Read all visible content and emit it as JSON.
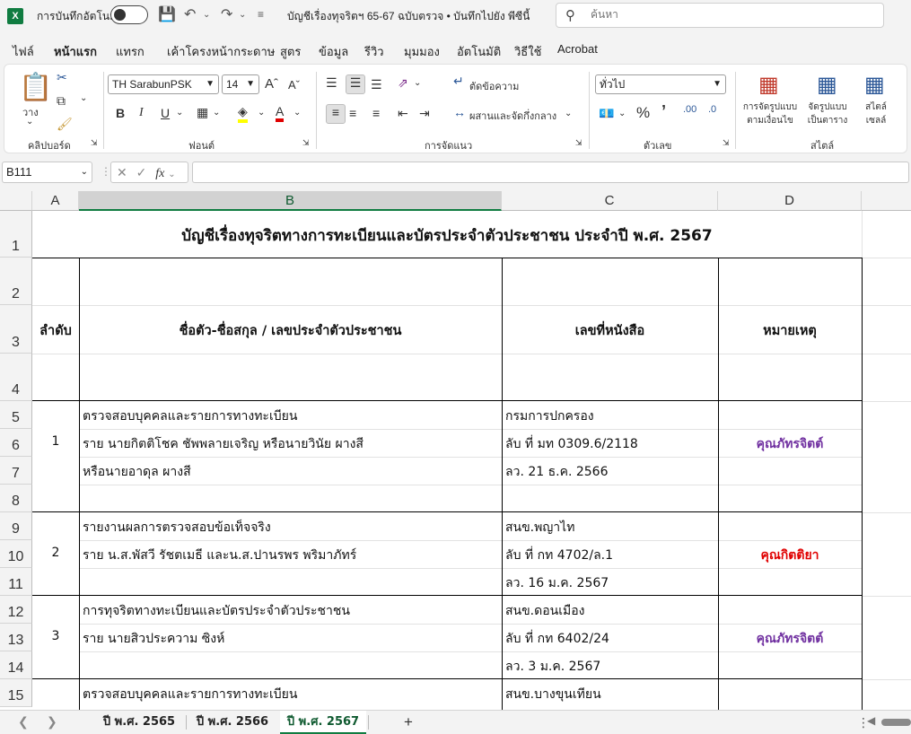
{
  "titlebar": {
    "app_icon": "X",
    "autosave_label": "การบันทึกอัตโนมัติ",
    "autosave_state": "off",
    "document_title": "บัญชีเรื่องทุจริตฯ 65-67 ฉบับตรวจ • บันทึกไปยัง พีซีนี้",
    "search_placeholder": "ค้นหา"
  },
  "ribbon_tabs": [
    "ไฟล์",
    "หน้าแรก",
    "แทรก",
    "เค้าโครงหน้ากระดาษ",
    "สูตร",
    "ข้อมูล",
    "รีวิว",
    "มุมมอง",
    "อัตโนมัติ",
    "วิธีใช้",
    "Acrobat"
  ],
  "active_tab": "หน้าแรก",
  "ribbon": {
    "clipboard": {
      "paste_label": "วาง",
      "group_label": "คลิปบอร์ด"
    },
    "font": {
      "font_name": "TH SarabunPSK",
      "font_size": "14",
      "group_label": "ฟอนต์"
    },
    "alignment": {
      "wrap_text": "ตัดข้อความ",
      "merge_center": "ผสานและจัดกึ่งกลาง",
      "group_label": "การจัดแนว"
    },
    "number": {
      "format": "ทั่วไป",
      "group_label": "ตัวเลข"
    },
    "styles": {
      "conditional_line1": "การจัดรูปแบบ",
      "conditional_line2": "ตามเงื่อนไข",
      "table_line1": "จัดรูปแบบ",
      "table_line2": "เป็นตาราง",
      "cell_line1": "สไตล์",
      "cell_line2": "เซลล์",
      "group_label": "สไตล์"
    }
  },
  "formula_bar": {
    "name_box": "B111",
    "formula": ""
  },
  "columns": [
    "A",
    "B",
    "C",
    "D"
  ],
  "selected_column": "B",
  "rows": [
    "1",
    "2",
    "3",
    "4",
    "5",
    "6",
    "7",
    "8",
    "9",
    "10",
    "11",
    "12",
    "13",
    "14",
    "15"
  ],
  "sheet": {
    "title": "บัญชีเรื่องทุจริตทางการทะเบียนและบัตรประจำตัวประชาชน ประจำปี พ.ศ. 2567",
    "headers": {
      "no": "ลำดับ",
      "name": "ชื่อตัว-ชื่อสกุล / เลขประจำตัวประชาชน",
      "letter": "เลขที่หนังสือ",
      "note": "หมายเหตุ"
    },
    "entries": [
      {
        "no": "1",
        "b": [
          "ตรวจสอบบุคคลและรายการทางทะเบียน",
          "ราย นายกิตติโชค ชัพพลายเจริญ หรือนายวินัย ผางสี",
          "หรือนายอาดุล ผางสี",
          ""
        ],
        "c": [
          "กรมการปกครอง",
          "ลับ ที่ มท 0309.6/2118",
          "ลว. 21 ธ.ค. 2566",
          ""
        ],
        "note": "คุณภัทรจิตต์",
        "note_color": "#7030a0"
      },
      {
        "no": "2",
        "b": [
          "รายงานผลการตรวจสอบข้อเท็จจริง",
          "ราย น.ส.พัสวี รัชตเมธี และน.ส.ปานรพร พริมาภัทร์",
          ""
        ],
        "c": [
          "สนข.พญาไท",
          "ลับ ที่ กท 4702/ล.1",
          "ลว. 16 ม.ค. 2567"
        ],
        "note": "คุณกิตติยา",
        "note_color": "#e00000"
      },
      {
        "no": "3",
        "b": [
          "การทุจริตทางทะเบียนและบัตรประจำตัวประชาชน",
          "ราย นายสิวประความ ซิงห์",
          ""
        ],
        "c": [
          "สนข.ดอนเมือง",
          "ลับ ที่ กท 6402/24",
          "ลว. 3 ม.ค. 2567"
        ],
        "note": "คุณภัทรจิตต์",
        "note_color": "#7030a0"
      },
      {
        "no": "",
        "b": [
          "ตรวจสอบบุคคลและรายการทางทะเบียน"
        ],
        "c": [
          "สนข.บางขุนเทียน"
        ],
        "note": ""
      }
    ]
  },
  "sheet_tabs": [
    "ปี พ.ศ. 2565",
    "ปี พ.ศ. 2566",
    "ปี พ.ศ. 2567"
  ],
  "active_sheet": "ปี พ.ศ. 2567",
  "add_sheet": "+"
}
